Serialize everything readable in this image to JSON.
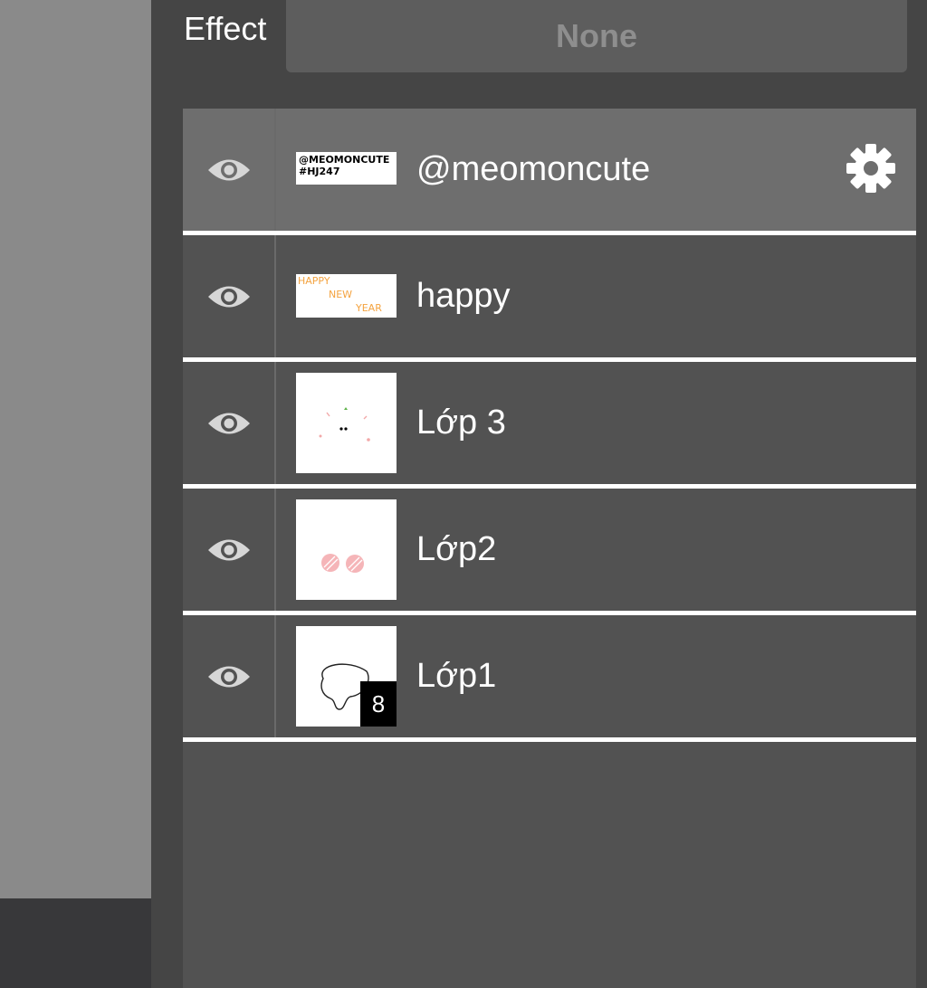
{
  "effect": {
    "label": "Effect",
    "value": "None"
  },
  "icons": {
    "visibility": "eye-icon",
    "settings": "gear-icon"
  },
  "colors": {
    "selected_row": "#6e6e6e",
    "row": "#525252",
    "separator": "#ffffff",
    "happy_new_year_text": "#f4a340"
  },
  "layers": [
    {
      "name": "@meomoncute",
      "selected": true,
      "thumbnail_text": [
        "@MEOMONCUTE",
        "#HJ247"
      ]
    },
    {
      "name": "happy",
      "selected": false,
      "thumbnail_text": [
        "HAPPY",
        "NEW",
        "YEAR"
      ]
    },
    {
      "name": "Lớp 3",
      "selected": false
    },
    {
      "name": "Lớp2",
      "selected": false
    },
    {
      "name": "Lớp1",
      "selected": false,
      "badge": "8"
    }
  ]
}
